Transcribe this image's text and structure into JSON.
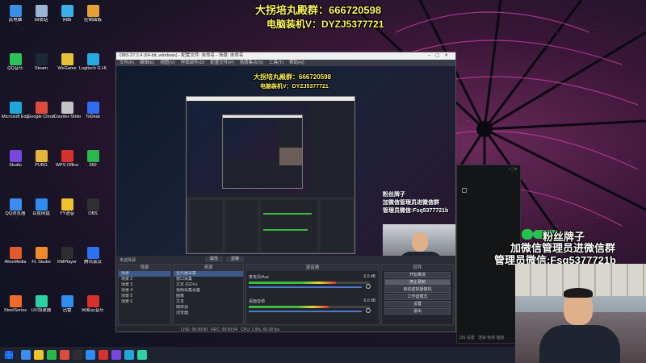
{
  "overlay": {
    "promo_line1": "大拐培丸殿群：666720598",
    "promo_line2": "电脑装机V：DYZJ5377721",
    "fan_badge": "粉丝牌子",
    "fan_line1": "粉丝牌子",
    "fan_line2": "加微信管理员进微信群",
    "fan_line3": "管理员微信:Fsq5377721b"
  },
  "desktop_icons": [
    {
      "label": "此电脑",
      "color": "#3a8ee6"
    },
    {
      "label": "回收站",
      "color": "#9ab4d8"
    },
    {
      "label": "网络",
      "color": "#3ab0e6"
    },
    {
      "label": "控制面板",
      "color": "#e6a03a"
    },
    {
      "label": "QQ音乐",
      "color": "#2bc45a"
    },
    {
      "label": "Steam",
      "color": "#1b2838"
    },
    {
      "label": "WeGame",
      "color": "#e6c23a"
    },
    {
      "label": "Logitech G HUB",
      "color": "#27a8e0"
    },
    {
      "label": "Microsoft Edge",
      "color": "#1fa7d9"
    },
    {
      "label": "Google Chrome",
      "color": "#e04a3a"
    },
    {
      "label": "Counter-Strike",
      "color": "#c4c4c4"
    },
    {
      "label": "ToDesk",
      "color": "#2f6cf0"
    },
    {
      "label": "Studio",
      "color": "#7a46e0"
    },
    {
      "label": "PUBG",
      "color": "#e6b43a"
    },
    {
      "label": "WPS Office",
      "color": "#d9312b"
    },
    {
      "label": "360",
      "color": "#29b84a"
    },
    {
      "label": "QQ浏览器",
      "color": "#3b8ef0"
    },
    {
      "label": "百度网盘",
      "color": "#2d8cf0"
    },
    {
      "label": "YY语音",
      "color": "#f0c22d"
    },
    {
      "label": "OBS",
      "color": "#303030"
    },
    {
      "label": "AliveMedia",
      "color": "#e05a2d"
    },
    {
      "label": "FL Studio",
      "color": "#f08a2d"
    },
    {
      "label": "KMPlayer",
      "color": "#2d2d2d"
    },
    {
      "label": "腾讯会议",
      "color": "#2d70f0"
    },
    {
      "label": "SteelSeries",
      "color": "#f06a2d"
    },
    {
      "label": "UU加速器",
      "color": "#2dd0a0"
    },
    {
      "label": "迅雷",
      "color": "#2d8ef0"
    },
    {
      "label": "网易云音乐",
      "color": "#d9312b"
    }
  ],
  "obs_main": {
    "title": "OBS 27.2.4 (64-bit, windows) - 配置文件: 未命名 - 场景: 未命名",
    "menu": [
      "文件(F)",
      "编辑(E)",
      "视图(V)",
      "停靠部件(D)",
      "配置文件(P)",
      "场景集合(S)",
      "工具(T)",
      "帮助(H)"
    ],
    "preview_label": "未选择源",
    "properties_btn": "属性",
    "filters_btn": "滤镜",
    "panels": {
      "scenes_title": "场景",
      "sources_title": "来源",
      "mixer_title": "混音器",
      "transitions_title": "场景转场",
      "controls_title": "控件"
    },
    "scenes": [
      "场景",
      "场景 2",
      "场景 3",
      "场景 4",
      "场景 5",
      "场景 6"
    ],
    "sources": [
      "显示器采集",
      "窗口采集",
      "文本 (GDI+)",
      "视频采集设备",
      "图像",
      "文本",
      "媒体源",
      "浏览器"
    ],
    "mixer": [
      {
        "name": "麦克风/Aux",
        "db": "0.0 dB",
        "level": 0.72
      },
      {
        "name": "桌面音频",
        "db": "0.0 dB",
        "level": 0.66
      }
    ],
    "controls": [
      "开始推流",
      "停止录制",
      "启动虚拟摄像机",
      "工作室模式",
      "设置",
      "退出"
    ],
    "active_control": "停止录制",
    "status": {
      "live": "LIVE: 00:00:00",
      "rec": "REC: 00:00:04",
      "cpu": "CPU: 1.9%, 60.00 fps"
    }
  },
  "dark_window": {
    "status": "195 设置",
    "footer": "渲染 帧率 缩放"
  },
  "taskbar": {
    "icons": [
      "#3b8ef0",
      "#f0c22d",
      "#29b84a",
      "#e04a3a",
      "#303030",
      "#2d8cf0",
      "#d9312b",
      "#7a46e0",
      "#1fa7d9",
      "#2dd0a0"
    ]
  }
}
